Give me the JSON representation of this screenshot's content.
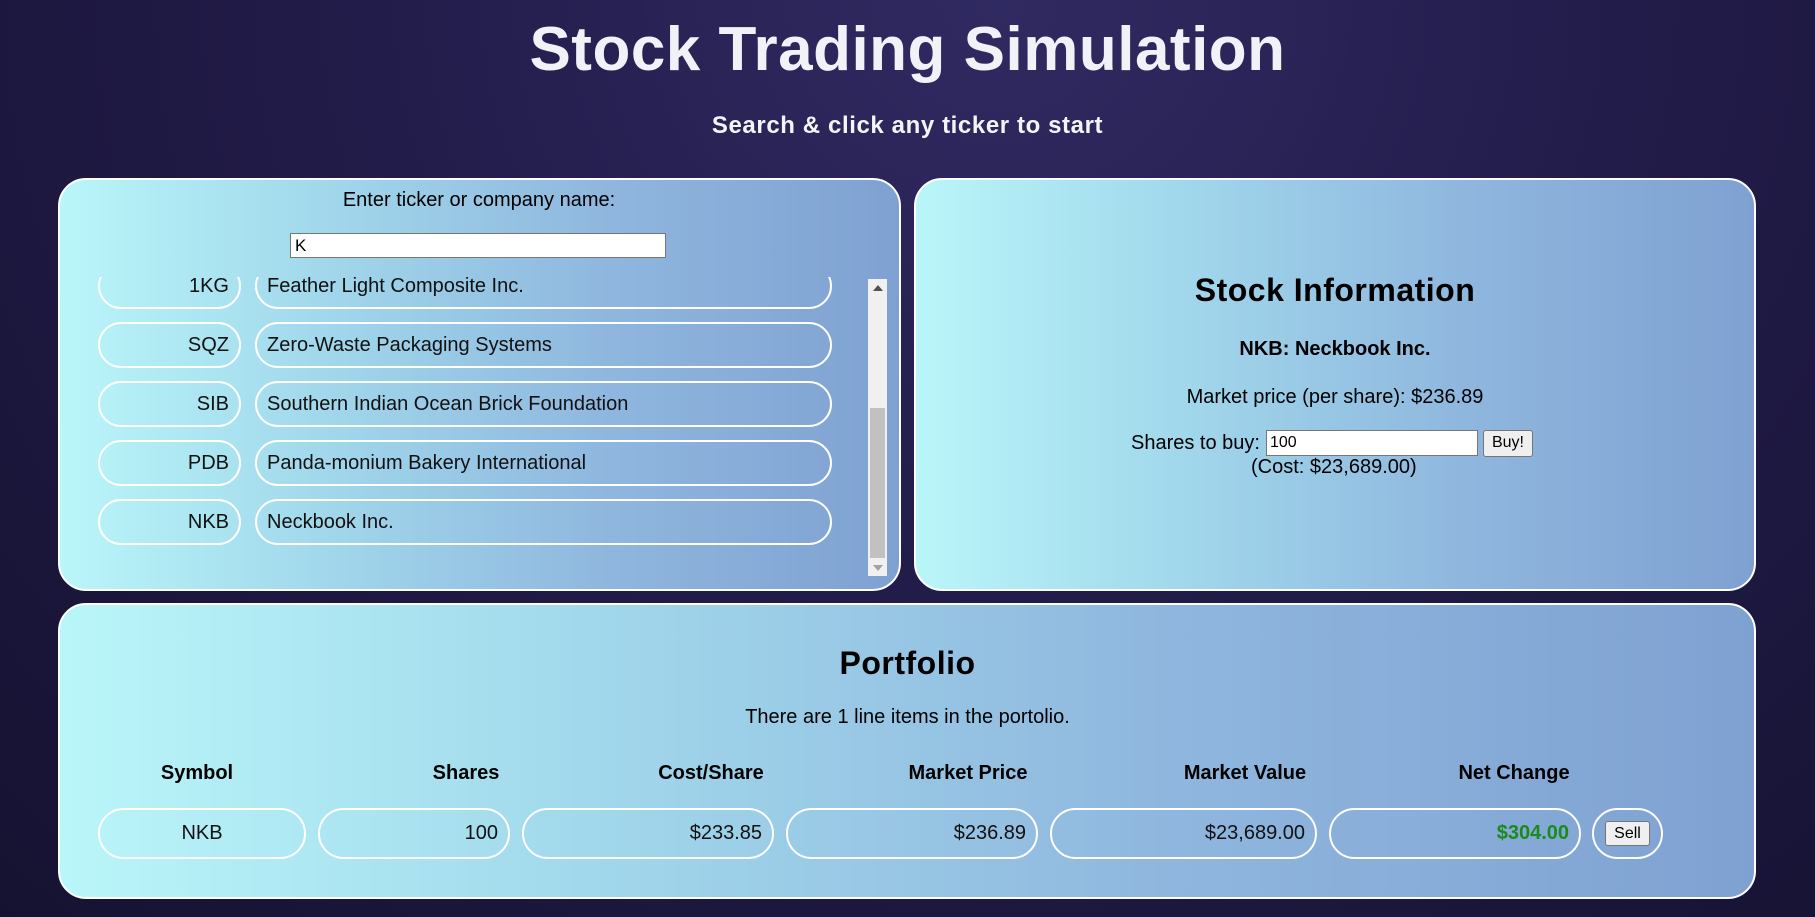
{
  "header": {
    "title": "Stock Trading Simulation",
    "subtitle": "Search & click any ticker to start"
  },
  "search": {
    "label": "Enter ticker or company name:",
    "value": "K",
    "results": [
      {
        "symbol": "1KG",
        "name": "Feather Light Composite Inc."
      },
      {
        "symbol": "SQZ",
        "name": "Zero-Waste Packaging Systems"
      },
      {
        "symbol": "SIB",
        "name": "Southern Indian Ocean Brick Foundation"
      },
      {
        "symbol": "PDB",
        "name": "Panda-monium Bakery International"
      },
      {
        "symbol": "NKB",
        "name": "Neckbook Inc."
      }
    ]
  },
  "stock_info": {
    "title": "Stock Information",
    "stock": "NKB: Neckbook Inc.",
    "market_price": "Market price (per share): $236.89",
    "shares_label": "Shares to buy:",
    "shares_value": "100",
    "buy_label": "Buy!",
    "cost": "(Cost: $23,689.00)"
  },
  "portfolio": {
    "title": "Portfolio",
    "summary": "There are 1 line items in the portolio.",
    "columns": [
      "Symbol",
      "Shares",
      "Cost/Share",
      "Market Price",
      "Market Value",
      "Net Change"
    ],
    "rows": [
      {
        "symbol": "NKB",
        "shares": "100",
        "cost_share": "$233.85",
        "market_price": "$236.89",
        "market_value": "$23,689.00",
        "net_change": "$304.00",
        "sell_label": "Sell"
      }
    ]
  },
  "colors": {
    "gain": "#1c8a1c"
  }
}
